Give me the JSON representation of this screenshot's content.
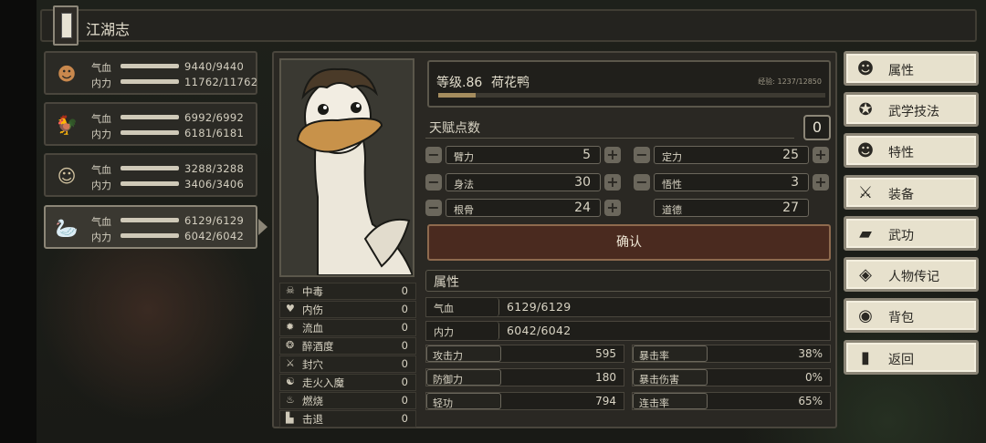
{
  "header": {
    "title": "江湖志"
  },
  "characters": [
    {
      "icon": "monk-avatar",
      "glyph": "☻",
      "hp_label": "气血",
      "mp_label": "内力",
      "hp": "9440/9440",
      "mp": "11762/11762",
      "selected": false
    },
    {
      "icon": "chicken-avatar",
      "glyph": "🐓",
      "hp_label": "气血",
      "mp_label": "内力",
      "hp": "6992/6992",
      "mp": "6181/6181",
      "selected": false
    },
    {
      "icon": "hat-man-avatar",
      "glyph": "☺",
      "hp_label": "气血",
      "mp_label": "内力",
      "hp": "3288/3288",
      "mp": "3406/3406",
      "selected": false
    },
    {
      "icon": "duck-avatar",
      "glyph": "🦢",
      "hp_label": "气血",
      "mp_label": "内力",
      "hp": "6129/6129",
      "mp": "6042/6042",
      "selected": true
    }
  ],
  "status_effects": [
    {
      "icon": "poison-icon",
      "glyph": "☠",
      "name": "中毒",
      "value": "0"
    },
    {
      "icon": "broken-heart-icon",
      "glyph": "♥",
      "name": "内伤",
      "value": "0"
    },
    {
      "icon": "bleed-icon",
      "glyph": "✹",
      "name": "流血",
      "value": "0"
    },
    {
      "icon": "drunk-icon",
      "glyph": "❂",
      "name": "醉酒度",
      "value": "0"
    },
    {
      "icon": "acupoint-icon",
      "glyph": "⚔",
      "name": "封穴",
      "value": "0"
    },
    {
      "icon": "qi-deviation-icon",
      "glyph": "☯",
      "name": "走火入魔",
      "value": "0"
    },
    {
      "icon": "burn-icon",
      "glyph": "♨",
      "name": "燃烧",
      "value": "0"
    },
    {
      "icon": "knockback-icon",
      "glyph": "▙",
      "name": "击退",
      "value": "0"
    }
  ],
  "level": {
    "label": "等级.86",
    "name": "荷花鸭",
    "exp": "经验: 1237/12850",
    "exp_fraction": 0.096
  },
  "talent": {
    "label": "天赋点数",
    "value": "0"
  },
  "attributes": [
    {
      "name": "臂力",
      "value": "5",
      "adjustable": true
    },
    {
      "name": "定力",
      "value": "25",
      "adjustable": true
    },
    {
      "name": "身法",
      "value": "30",
      "adjustable": true
    },
    {
      "name": "悟性",
      "value": "3",
      "adjustable": true
    },
    {
      "name": "根骨",
      "value": "24",
      "adjustable": true
    },
    {
      "name": "道德",
      "value": "27",
      "adjustable": false
    }
  ],
  "confirm_label": "确认",
  "properties": {
    "title": "属性",
    "hp_label": "气血",
    "hp": "6129/6129",
    "mp_label": "内力",
    "mp": "6042/6042",
    "stats": [
      {
        "name": "攻击力",
        "value": "595"
      },
      {
        "name": "暴击率",
        "value": "38%"
      },
      {
        "name": "防御力",
        "value": "180"
      },
      {
        "name": "暴击伤害",
        "value": "0%"
      },
      {
        "name": "轻功",
        "value": "794"
      },
      {
        "name": "连击率",
        "value": "65%"
      }
    ]
  },
  "menu": [
    {
      "icon": "person-icon",
      "glyph": "☻",
      "label": "属性"
    },
    {
      "icon": "martial-skill-icon",
      "glyph": "✪",
      "label": "武学技法"
    },
    {
      "icon": "trait-icon",
      "glyph": "☻",
      "label": "特性"
    },
    {
      "icon": "sword-icon",
      "glyph": "⚔",
      "label": "装备"
    },
    {
      "icon": "book-icon",
      "glyph": "▰",
      "label": "武功"
    },
    {
      "icon": "biography-icon",
      "glyph": "◈",
      "label": "人物传记"
    },
    {
      "icon": "bag-icon",
      "glyph": "◉",
      "label": "背包"
    },
    {
      "icon": "door-icon",
      "glyph": "▮",
      "label": "返回"
    }
  ]
}
